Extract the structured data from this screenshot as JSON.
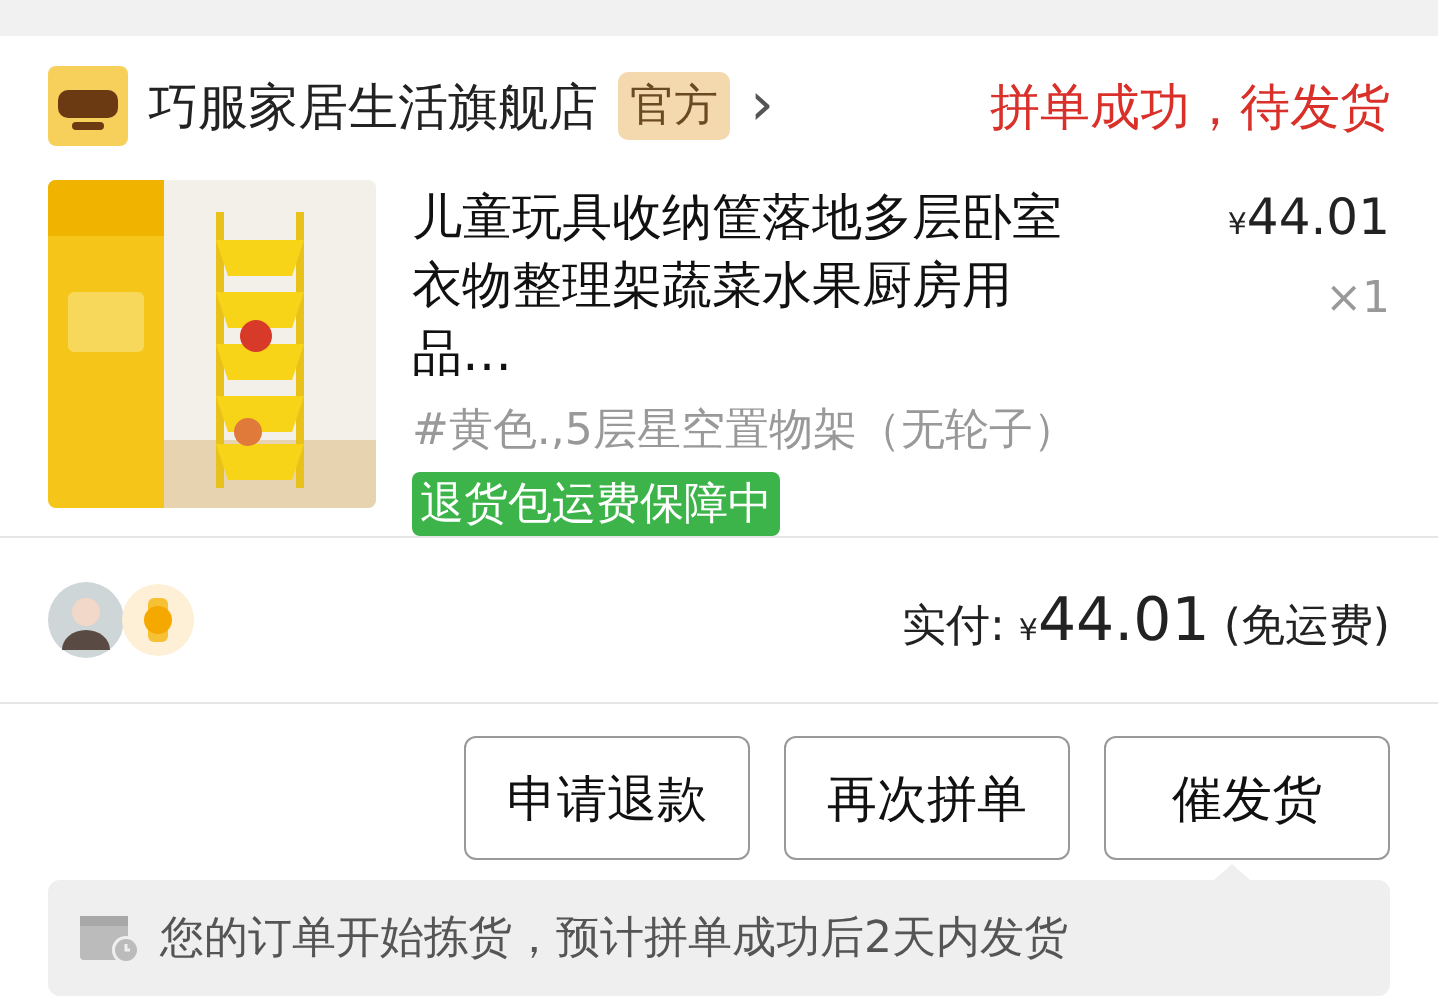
{
  "store": {
    "name": "巧服家居生活旗舰店",
    "badge": "官方",
    "chevron": "›"
  },
  "status": "拼单成功，待发货",
  "product": {
    "kind": "picture",
    "title": "儿童玩具收纳筐落地多层卧室衣物整理架蔬菜水果厨房用品…",
    "price_symbol": "¥",
    "price": "44.01",
    "quantity": "×1",
    "spec": "#黄色.,5层星空置物架（无轮子）",
    "guarantee": "退货包运费保障中"
  },
  "payment": {
    "label": "实付:",
    "symbol": "¥",
    "amount": "44.01",
    "note": "(免运费)"
  },
  "buttons": [
    "申请退款",
    "再次拼单",
    "催发货"
  ],
  "notice": "您的订单开始拣货，预计拼单成功后2天内发货"
}
